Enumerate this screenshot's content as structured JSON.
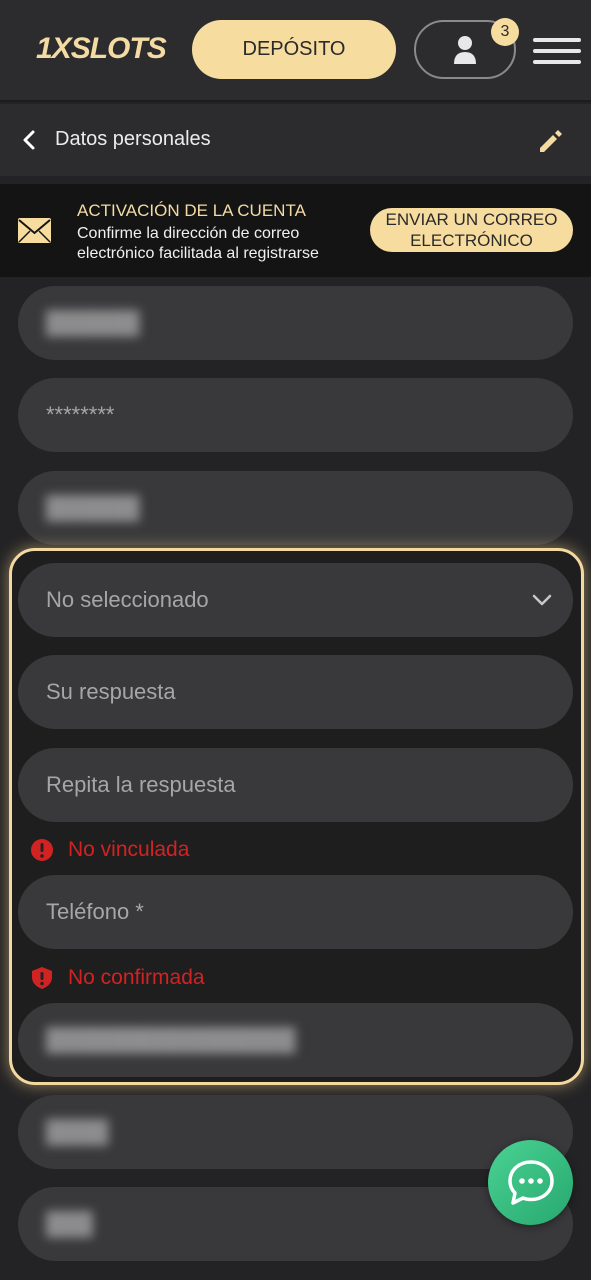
{
  "header": {
    "logo": "1XSLOTS",
    "deposit_label": "DEPÓSITO",
    "notification_count": "3"
  },
  "subbar": {
    "title": "Datos personales"
  },
  "banner": {
    "title": "ACTIVACIÓN DE LA CUENTA",
    "text": "Confirme la dirección de correo electrónico facilitada al registrarse",
    "button_label": "ENVIAR UN CORREO ELECTRÓNICO"
  },
  "fields": {
    "password_value": "********",
    "security_question": "No seleccionado",
    "answer_placeholder": "Su respuesta",
    "repeat_answer_placeholder": "Repita la respuesta",
    "phone_status": "No vinculada",
    "phone_placeholder": "Teléfono *",
    "email_status": "No confirmada"
  },
  "icons": {
    "back": "chevron-left-icon",
    "edit": "pencil-icon",
    "mail": "envelope-icon",
    "profile": "user-icon",
    "menu": "hamburger-icon",
    "dropdown": "chevron-down-icon",
    "alert": "exclamation-circle-icon",
    "shield": "shield-alert-icon",
    "chat": "chat-bubble-icon"
  },
  "colors": {
    "accent": "#f7dca0",
    "error": "#d22323",
    "chat": "#3cc283"
  }
}
